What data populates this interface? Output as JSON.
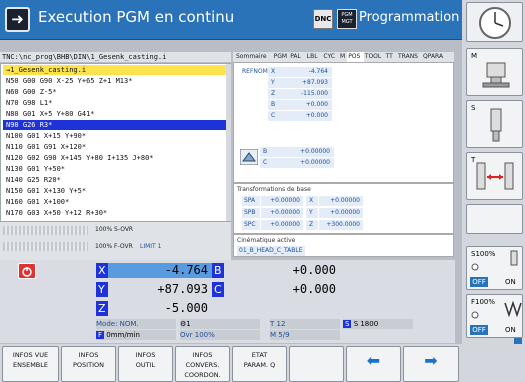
{
  "header": {
    "mode_title": "Execution PGM en continu",
    "dnc_label": "DNC",
    "pgm_icon_label": "PGM MGT",
    "prog_title": "Programmation"
  },
  "program": {
    "path": "TNC:\\nc_prog\\BHB\\DIN\\1_Gesenk_casting.i",
    "lines": [
      {
        "text": "→1_Gesenk_casting.i",
        "state": "current"
      },
      {
        "text": "N50 G00 G90 X-25 Y+65 Z+1 M13*",
        "state": ""
      },
      {
        "text": "N60 G00 Z-5*",
        "state": ""
      },
      {
        "text": "N70 G98 L1*",
        "state": ""
      },
      {
        "text": "N80 G01 X+5 Y+80 G41*",
        "state": ""
      },
      {
        "text": "N90 G26 R3*",
        "state": "selected"
      },
      {
        "text": "N100 G01 X+15 Y+90*",
        "state": ""
      },
      {
        "text": "N110 G01 G91 X+120*",
        "state": ""
      },
      {
        "text": "N120 G02 G90 X+145 Y+80 I+135 J+80*",
        "state": ""
      },
      {
        "text": "N130 G01 Y+50*",
        "state": ""
      },
      {
        "text": "N140 G25 R20*",
        "state": ""
      },
      {
        "text": "N150 G01 X+130 Y+5*",
        "state": ""
      },
      {
        "text": "N160 G01 X+100*",
        "state": ""
      },
      {
        "text": "N170 G03 X+50 Y+12 R+30*",
        "state": ""
      }
    ]
  },
  "status_tabs": [
    "Sommaire",
    "PGM",
    "PAL",
    "LBL",
    "CYC",
    "M",
    "POS",
    "TOOL",
    "TT",
    "TRANS",
    "QPARA"
  ],
  "active_tab": "POS",
  "refnom": {
    "label": "REFNOM",
    "rows": [
      {
        "axis": "X",
        "value": "-4.764"
      },
      {
        "axis": "Y",
        "value": "+87.093"
      },
      {
        "axis": "Z",
        "value": "-115.000"
      },
      {
        "axis": "B",
        "value": "+0.000"
      },
      {
        "axis": "C",
        "value": "+0.000"
      }
    ]
  },
  "rotary": [
    {
      "axis": "B",
      "value": "+0.00000"
    },
    {
      "axis": "C",
      "value": "+0.00000"
    }
  ],
  "basis": {
    "title": "Transformations de base",
    "rows": [
      {
        "l1": "SPA",
        "v1": "+0.00000",
        "l2": "X",
        "v2": "+0.00000"
      },
      {
        "l1": "SPB",
        "v1": "+0.00000",
        "l2": "Y",
        "v2": "+0.00000"
      },
      {
        "l1": "SPC",
        "v1": "+0.00000",
        "l2": "Z",
        "v2": "+300.0000"
      }
    ]
  },
  "kinematic": {
    "title": "Cinématique active",
    "value": "01_B_HEAD_C_TABLE"
  },
  "overrides": {
    "s_ovr": "100% S-OVR",
    "f_ovr": "100% F-OVR",
    "limit": "LIMIT 1"
  },
  "positions": [
    {
      "axis": "X",
      "value": "-4.764"
    },
    {
      "axis": "Y",
      "value": "+87.093"
    },
    {
      "axis": "Z",
      "value": "-5.000"
    }
  ],
  "positions_rot": [
    {
      "axis": "B",
      "value": "+0.000"
    },
    {
      "axis": "C",
      "value": "+0.000"
    }
  ],
  "status_row": {
    "mode": "Mode: NOM.",
    "feed": "0mm/min",
    "ovr": "Ovr 100%",
    "tool": "T 12",
    "spindle": "S 1800",
    "m_func": "M 5/9",
    "tool_icon": "1"
  },
  "right_panel": {
    "s100": "S100%",
    "f100": "F100%",
    "off": "OFF",
    "on": "ON",
    "m_label": "M",
    "s_label": "S",
    "t_label": "T"
  },
  "softkeys": [
    {
      "l1": "INFOS VUE",
      "l2": "ENSEMBLE"
    },
    {
      "l1": "INFOS",
      "l2": "POSITION"
    },
    {
      "l1": "INFOS",
      "l2": "OUTIL"
    },
    {
      "l1": "INFOS",
      "l2": "CONVERS.",
      "l3": "COORDON."
    },
    {
      "l1": "ETAT",
      "l2": "PARAM. Q"
    },
    {
      "l1": "",
      "l2": ""
    },
    {
      "l1": "",
      "l2": ""
    },
    {
      "l1": "",
      "l2": ""
    }
  ],
  "colors": {
    "header_blue": "#2a73b8",
    "select_blue": "#1d33d8",
    "current_yellow": "#ffe34d"
  }
}
